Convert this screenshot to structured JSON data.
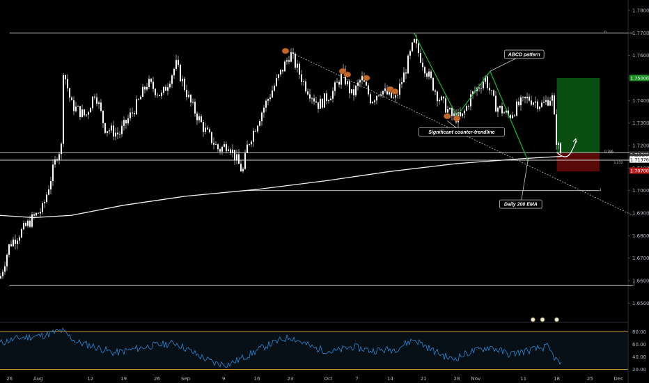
{
  "chart_data": {
    "type": "candlestick",
    "colors": {
      "background": "#000000",
      "candle": "#ffffff",
      "rsi_line": "#2b8bd8",
      "rsi_bands": "#e0a63b",
      "ema": "#f2f2f2",
      "touch_marker": "#c0692c",
      "abcd_leg": "#1fb83a",
      "target_zone": "#0b5a13",
      "stop_zone": "#6a0b0b"
    },
    "price_axis": {
      "range": [
        1.643,
        1.784
      ],
      "ticks": [
        "1.78000",
        "1.77000",
        "1.76000",
        "1.75000",
        "1.74000",
        "1.73000",
        "1.72000",
        "1.71000",
        "1.70000",
        "1.69000",
        "1.68000",
        "1.67000",
        "1.66000",
        "1.65000"
      ],
      "tick_values": [
        1.78,
        1.77,
        1.76,
        1.75,
        1.74,
        1.73,
        1.72,
        1.71,
        1.7,
        1.69,
        1.68,
        1.67,
        1.66,
        1.65
      ]
    },
    "price_tags": [
      {
        "label": "1.75000",
        "value": 1.75,
        "bg": "#1a8f23",
        "fg": "#ffffff"
      },
      {
        "label": "1.71601",
        "value": 1.71601,
        "bg": "#3a3a3a",
        "fg": "#ffffff"
      },
      {
        "label": "02:44:35",
        "value": 1.7148,
        "bg": "#3a3a3a",
        "fg": "#ffffff"
      },
      {
        "label": "1.71376",
        "value": 1.71376,
        "bg": "#ffffff",
        "fg": "#000000"
      },
      {
        "label": "1.70700",
        "value": 1.70885,
        "bg": "#b71c1c",
        "fg": "#ffffff"
      }
    ],
    "time_axis": {
      "range": [
        "2020-07-24",
        "2020-12-03"
      ],
      "labels": [
        {
          "label": "26",
          "date": "2020-07-26"
        },
        {
          "label": "Aug",
          "date": "2020-08-01"
        },
        {
          "label": "12",
          "date": "2020-08-12"
        },
        {
          "label": "19",
          "date": "2020-08-19"
        },
        {
          "label": "26",
          "date": "2020-08-26"
        },
        {
          "label": "Sep",
          "date": "2020-09-01"
        },
        {
          "label": "9",
          "date": "2020-09-09"
        },
        {
          "label": "16",
          "date": "2020-09-16"
        },
        {
          "label": "23",
          "date": "2020-09-23"
        },
        {
          "label": "Oct",
          "date": "2020-10-01"
        },
        {
          "label": "7",
          "date": "2020-10-07"
        },
        {
          "label": "14",
          "date": "2020-10-14"
        },
        {
          "label": "21",
          "date": "2020-10-21"
        },
        {
          "label": "28",
          "date": "2020-10-28"
        },
        {
          "label": "Nov",
          "date": "2020-11-01"
        },
        {
          "label": "11",
          "date": "2020-11-11"
        },
        {
          "label": "18",
          "date": "2020-11-18"
        },
        {
          "label": "25",
          "date": "2020-11-25"
        },
        {
          "label": "Dec",
          "date": "2020-12-01"
        }
      ]
    },
    "price_path": [
      [
        "2020-07-24",
        1.661
      ],
      [
        "2020-07-26",
        1.676
      ],
      [
        "2020-07-29",
        1.683
      ],
      [
        "2020-07-31",
        1.688
      ],
      [
        "2020-08-02",
        1.692
      ],
      [
        "2020-08-04",
        1.708
      ],
      [
        "2020-08-05",
        1.716
      ],
      [
        "2020-08-06",
        1.72
      ],
      [
        "2020-08-06",
        1.757
      ],
      [
        "2020-08-08",
        1.738
      ],
      [
        "2020-08-11",
        1.733
      ],
      [
        "2020-08-13",
        1.744
      ],
      [
        "2020-08-15",
        1.728
      ],
      [
        "2020-08-18",
        1.725
      ],
      [
        "2020-08-20",
        1.732
      ],
      [
        "2020-08-22",
        1.739
      ],
      [
        "2020-08-24",
        1.748
      ],
      [
        "2020-08-27",
        1.742
      ],
      [
        "2020-08-30",
        1.756
      ],
      [
        "2020-09-02",
        1.739
      ],
      [
        "2020-09-05",
        1.727
      ],
      [
        "2020-09-08",
        1.718
      ],
      [
        "2020-09-10",
        1.721
      ],
      [
        "2020-09-13",
        1.708
      ],
      [
        "2020-09-14",
        1.72
      ],
      [
        "2020-09-17",
        1.735
      ],
      [
        "2020-09-20",
        1.748
      ],
      [
        "2020-09-23",
        1.761
      ],
      [
        "2020-09-26",
        1.747
      ],
      [
        "2020-09-29",
        1.738
      ],
      [
        "2020-10-02",
        1.744
      ],
      [
        "2020-10-04",
        1.752
      ],
      [
        "2020-10-06",
        1.742
      ],
      [
        "2020-10-08",
        1.75
      ],
      [
        "2020-10-10",
        1.74
      ],
      [
        "2020-10-12",
        1.745
      ],
      [
        "2020-10-15",
        1.74
      ],
      [
        "2020-10-17",
        1.752
      ],
      [
        "2020-10-19",
        1.766
      ],
      [
        "2020-10-21",
        1.756
      ],
      [
        "2020-10-24",
        1.742
      ],
      [
        "2020-10-27",
        1.733
      ],
      [
        "2020-10-29",
        1.732
      ],
      [
        "2020-10-31",
        1.742
      ],
      [
        "2020-11-03",
        1.75
      ],
      [
        "2020-11-05",
        1.738
      ],
      [
        "2020-11-08",
        1.733
      ],
      [
        "2020-11-10",
        1.738
      ],
      [
        "2020-11-12",
        1.741
      ],
      [
        "2020-11-15",
        1.738
      ],
      [
        "2020-11-17",
        1.742
      ],
      [
        "2020-11-18",
        1.721
      ],
      [
        "2020-11-19",
        1.716
      ]
    ],
    "ema_path": [
      [
        "2020-07-24",
        1.689
      ],
      [
        "2020-07-31",
        1.688
      ],
      [
        "2020-08-08",
        1.689
      ],
      [
        "2020-08-19",
        1.6935
      ],
      [
        "2020-09-01",
        1.6975
      ],
      [
        "2020-09-16",
        1.7005
      ],
      [
        "2020-10-01",
        1.7045
      ],
      [
        "2020-10-14",
        1.7085
      ],
      [
        "2020-10-28",
        1.712
      ],
      [
        "2020-11-11",
        1.7142
      ],
      [
        "2020-11-19",
        1.7152
      ]
    ],
    "horizontal_levels": [
      {
        "value": 1.77,
        "from": "2020-07-26",
        "to": "2020-12-04"
      },
      {
        "value": 1.7168,
        "from": "2020-07-24",
        "to": "2020-12-04"
      },
      {
        "value": 1.7135,
        "from": "2020-07-24",
        "to": "2020-12-04"
      },
      {
        "value": 1.7,
        "from": "2020-09-14",
        "to": "2020-11-27"
      },
      {
        "value": 1.658,
        "from": "2020-07-26",
        "to": "2020-12-04"
      }
    ],
    "level_labels": [
      {
        "text": "0",
        "date": "2020-11-28",
        "value": 1.7705
      },
      {
        "text": "0.786",
        "date": "2020-11-28",
        "value": 1.7175
      },
      {
        "text": "1.272",
        "date": "2020-11-30",
        "value": 1.7125
      },
      {
        "text": "1",
        "date": "2020-11-27",
        "value": 1.7005
      },
      {
        "text": "1",
        "date": "2020-12-04",
        "value": 1.6585
      }
    ],
    "counter_trendline": {
      "from": [
        "2020-09-22",
        1.7625
      ],
      "to": [
        "2020-12-04",
        1.689
      ]
    },
    "touch_points": [
      [
        "2020-09-22",
        1.762
      ],
      [
        "2020-10-04",
        1.753
      ],
      [
        "2020-10-05",
        1.7515
      ],
      [
        "2020-10-09",
        1.75
      ],
      [
        "2020-10-14",
        1.745
      ],
      [
        "2020-10-15",
        1.744
      ],
      [
        "2020-10-26",
        1.733
      ],
      [
        "2020-10-28",
        1.732
      ]
    ],
    "abcd_legs": [
      {
        "from": [
          "2020-10-19",
          1.77
        ],
        "to": [
          "2020-10-28",
          1.733
        ]
      },
      {
        "from": [
          "2020-10-28",
          1.733
        ],
        "to": [
          "2020-11-04",
          1.753
        ]
      },
      {
        "from": [
          "2020-11-04",
          1.753
        ],
        "to": [
          "2020-11-12",
          1.713
        ]
      }
    ],
    "position": {
      "from": "2020-11-18",
      "to": "2020-11-27",
      "target": 1.75,
      "entry": 1.7168,
      "stop": 1.7085
    },
    "projection_arrow": [
      [
        "2020-11-18",
        1.717
      ],
      [
        "2020-11-20",
        1.713
      ],
      [
        "2020-11-21",
        1.717
      ],
      [
        "2020-11-22",
        1.722
      ]
    ],
    "annotations": [
      {
        "text": "ABCD pattern",
        "date": "2020-11-07",
        "value": 1.7605,
        "pointer": [
          "2020-11-04",
          1.753
        ]
      },
      {
        "text": "Significant counter-trendline",
        "date": "2020-10-20",
        "value": 1.726,
        "pointer": [
          "2020-10-26",
          1.731
        ]
      },
      {
        "text": "Daily 200 EMA",
        "date": "2020-11-06",
        "value": 1.694,
        "pointer": [
          "2020-11-12",
          1.7142
        ]
      }
    ],
    "event_icons": [
      "2020-11-13",
      "2020-11-15",
      "2020-11-18"
    ],
    "rsi": {
      "axis_ticks": [
        "80.00",
        "60.00",
        "40.00",
        "20.00"
      ],
      "tick_values": [
        80,
        60,
        40,
        20
      ],
      "range": [
        14,
        87
      ],
      "upper_band": 80,
      "lower_band": 20,
      "path": [
        [
          "2020-07-24",
          62
        ],
        [
          "2020-07-28",
          70
        ],
        [
          "2020-08-02",
          74
        ],
        [
          "2020-08-06",
          82
        ],
        [
          "2020-08-09",
          64
        ],
        [
          "2020-08-13",
          56
        ],
        [
          "2020-08-17",
          46
        ],
        [
          "2020-08-21",
          52
        ],
        [
          "2020-08-25",
          58
        ],
        [
          "2020-08-30",
          62
        ],
        [
          "2020-09-03",
          45
        ],
        [
          "2020-09-07",
          30
        ],
        [
          "2020-09-10",
          28
        ],
        [
          "2020-09-14",
          42
        ],
        [
          "2020-09-18",
          58
        ],
        [
          "2020-09-23",
          72
        ],
        [
          "2020-09-28",
          54
        ],
        [
          "2020-10-02",
          48
        ],
        [
          "2020-10-06",
          56
        ],
        [
          "2020-10-10",
          50
        ],
        [
          "2020-10-15",
          52
        ],
        [
          "2020-10-19",
          68
        ],
        [
          "2020-10-23",
          50
        ],
        [
          "2020-10-27",
          36
        ],
        [
          "2020-10-31",
          48
        ],
        [
          "2020-11-04",
          56
        ],
        [
          "2020-11-08",
          44
        ],
        [
          "2020-11-12",
          50
        ],
        [
          "2020-11-16",
          56
        ],
        [
          "2020-11-18",
          34
        ],
        [
          "2020-11-19",
          28
        ]
      ]
    }
  }
}
